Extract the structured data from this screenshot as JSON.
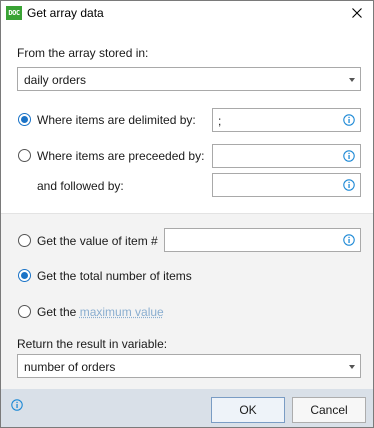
{
  "window": {
    "title": "Get array data",
    "app_icon_text": "DOC"
  },
  "source": {
    "label": "From the array stored in:",
    "selected": "daily orders"
  },
  "options": {
    "delimited": {
      "label": "Where items are delimited by:",
      "value": ";",
      "checked": true
    },
    "preceeded": {
      "label": "Where items are preceeded by:",
      "value": "",
      "checked": false
    },
    "followed": {
      "label": "and followed by:",
      "value": ""
    }
  },
  "modes": {
    "item_value": {
      "label": "Get the value of item #",
      "value": "",
      "checked": false
    },
    "total": {
      "label": "Get the total number of items",
      "checked": true
    },
    "max": {
      "label_prefix": "Get the",
      "link": "maximum value",
      "checked": false
    }
  },
  "result": {
    "label": "Return the result in variable:",
    "selected": "number of orders"
  },
  "footer": {
    "ok": "OK",
    "cancel": "Cancel"
  },
  "colors": {
    "accent": "#1a73c7",
    "info_icon": "#1f8ad6",
    "footer_bg": "#d9e0e8",
    "section_bg": "#f3f3f3"
  }
}
